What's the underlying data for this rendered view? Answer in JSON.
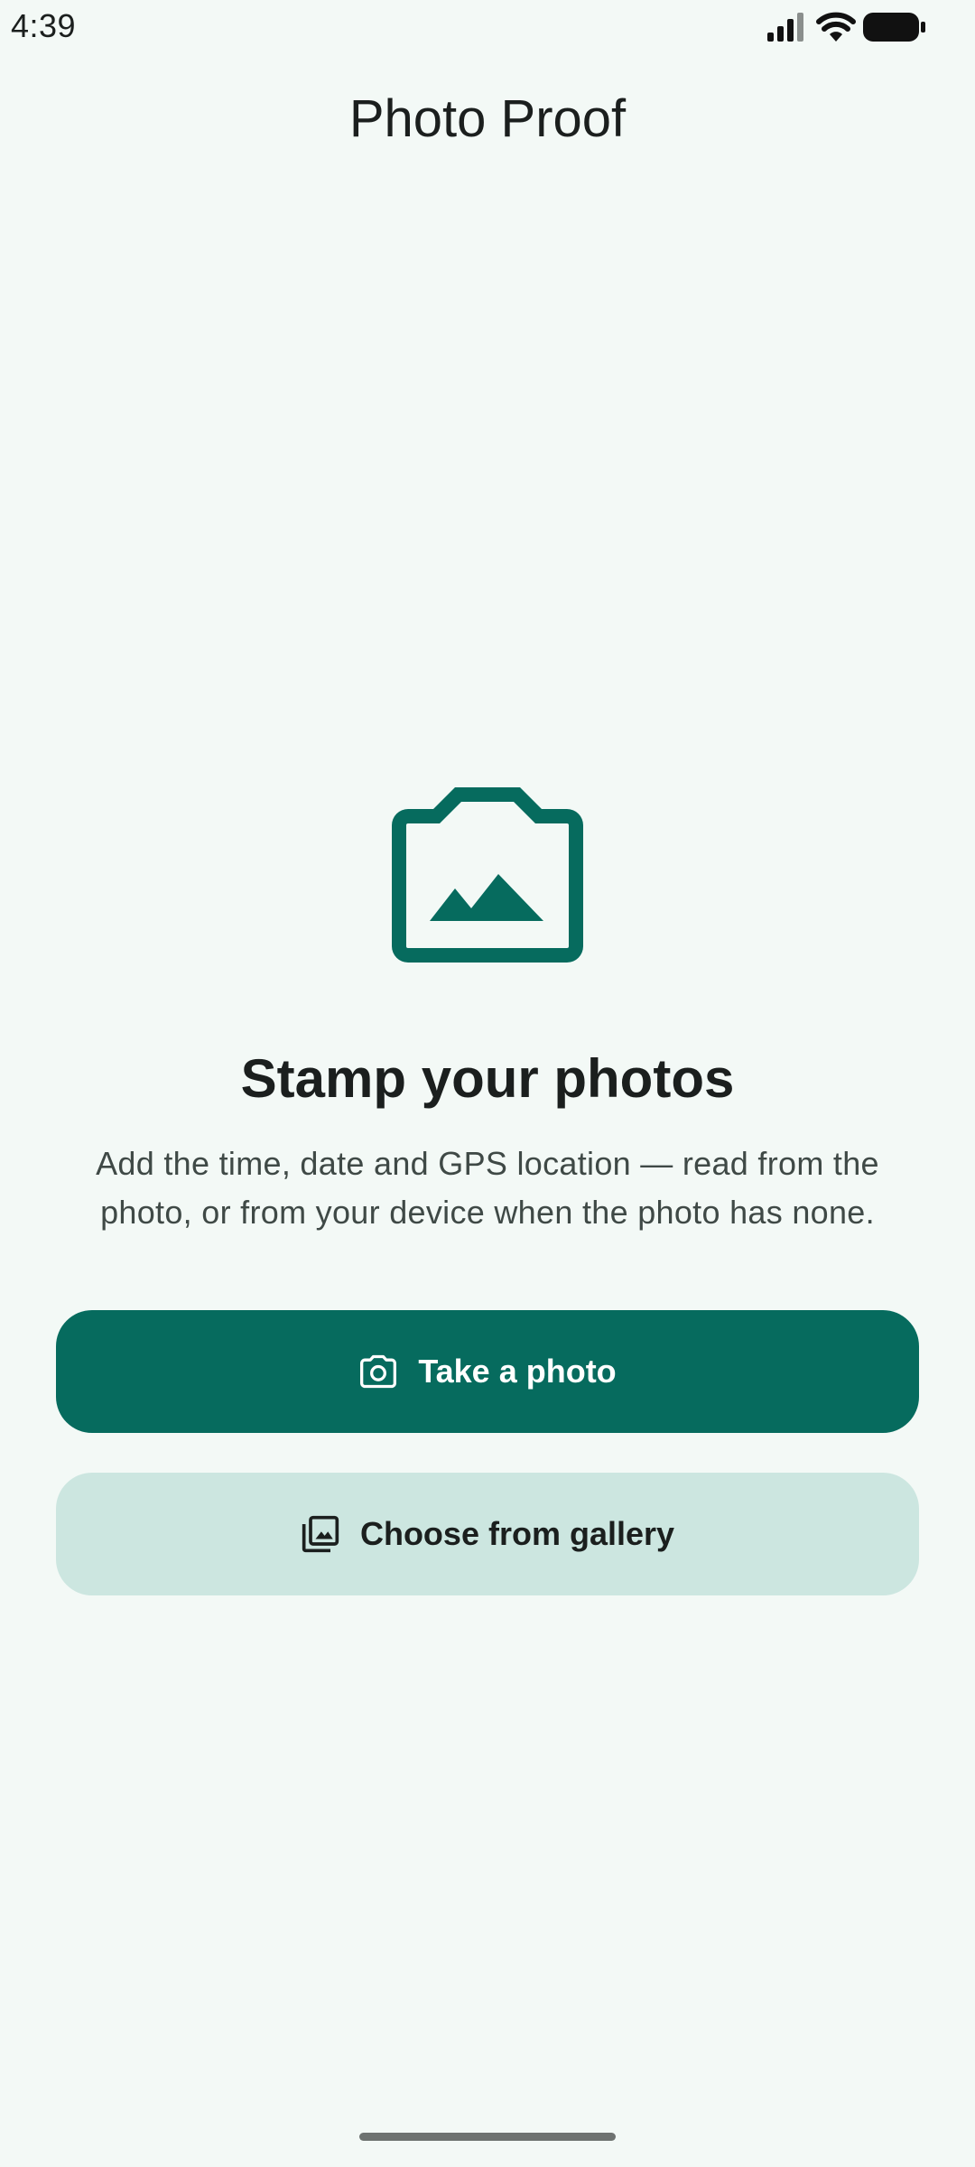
{
  "status_bar": {
    "time": "4:39",
    "icons": [
      "cellular-signal-icon",
      "wifi-icon",
      "battery-icon"
    ]
  },
  "app_bar": {
    "title": "Photo Proof"
  },
  "hero": {
    "icon": "camera-image-icon",
    "headline": "Stamp your photos",
    "description": "Add the time, date and GPS location — read from the photo, or from your device when the photo has none."
  },
  "actions": {
    "take_photo": {
      "label": "Take a photo",
      "icon": "camera-icon"
    },
    "choose_gallery": {
      "label": "Choose from gallery",
      "icon": "photo-library-icon"
    }
  },
  "colors": {
    "background": "#f3f9f6",
    "primary": "#066b5e",
    "secondary_container": "#cce6e0",
    "on_surface": "#1b1f1e",
    "on_surface_variant": "#3f4946"
  }
}
